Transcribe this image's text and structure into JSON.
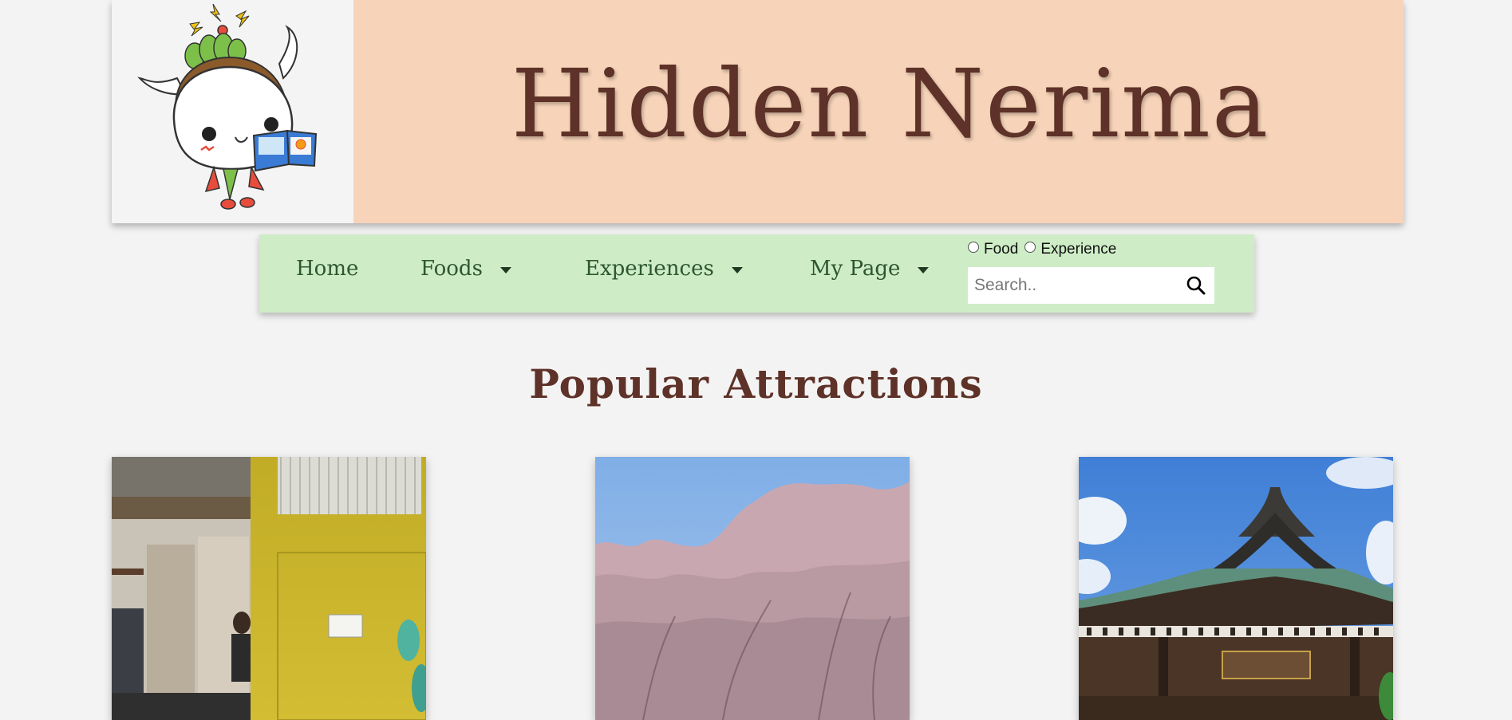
{
  "header": {
    "site_title": "Hidden Nerima",
    "logo_icon": "mascot-logo-icon",
    "background_color": "#f7d4b9",
    "title_color": "#5e3228"
  },
  "nav": {
    "background_color": "#ceedc6",
    "items": [
      {
        "label": "Home",
        "has_dropdown": false
      },
      {
        "label": "Foods",
        "has_dropdown": true
      },
      {
        "label": "Experiences",
        "has_dropdown": true
      },
      {
        "label": "My Page",
        "has_dropdown": true
      }
    ],
    "search": {
      "filters": [
        {
          "label": "Food",
          "checked": false
        },
        {
          "label": "Experience",
          "checked": false
        }
      ],
      "placeholder": "Search..",
      "value": "",
      "button_icon": "search-icon"
    }
  },
  "main": {
    "section_title": "Popular Attractions",
    "cards": [
      {
        "image_icon": "cafe-interior-photo"
      },
      {
        "image_icon": "cherry-blossom-photo"
      },
      {
        "image_icon": "temple-gate-photo"
      }
    ]
  }
}
